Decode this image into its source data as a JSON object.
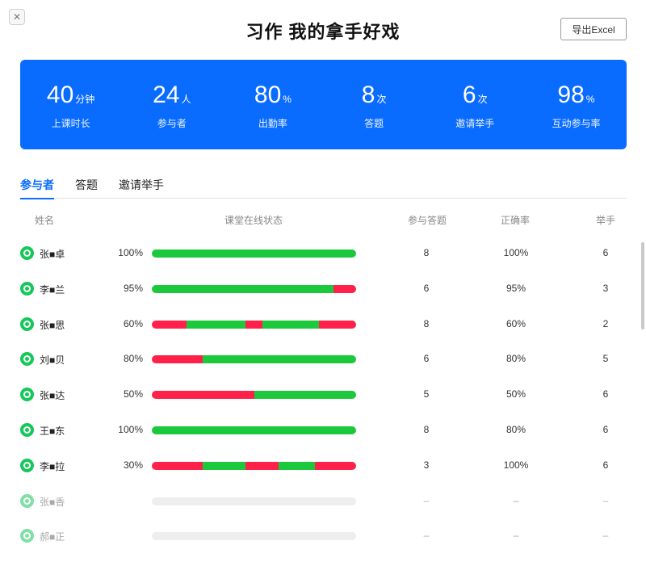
{
  "page": {
    "title": "习作 我的拿手好戏",
    "close_glyph": "✕"
  },
  "toolbar": {
    "export_label": "导出Excel"
  },
  "stats": [
    {
      "value": "40",
      "unit": "分钟",
      "label": "上课时长"
    },
    {
      "value": "24",
      "unit": "人",
      "label": "参与者"
    },
    {
      "value": "80",
      "unit": "%",
      "label": "出勤率"
    },
    {
      "value": "8",
      "unit": "次",
      "label": "答题"
    },
    {
      "value": "6",
      "unit": "次",
      "label": "邀请举手"
    },
    {
      "value": "98",
      "unit": "%",
      "label": "互动参与率"
    }
  ],
  "tabs": [
    {
      "label": "参与者",
      "active": true
    },
    {
      "label": "答题",
      "active": false
    },
    {
      "label": "邀请举手",
      "active": false
    }
  ],
  "table": {
    "headers": {
      "name": "姓名",
      "status": "课堂在线状态",
      "answers": "参与答题",
      "accuracy": "正确率",
      "hands": "举手"
    },
    "colors": {
      "online": "#1dc93c",
      "offline": "#ff2149",
      "empty": "#eeeeee"
    },
    "rows": [
      {
        "name": "张■卓",
        "pct": "100%",
        "segments": [
          [
            "online",
            1
          ]
        ],
        "answers": "8",
        "accuracy": "100%",
        "hands": "6",
        "active": true
      },
      {
        "name": "李■兰",
        "pct": "95%",
        "segments": [
          [
            "online",
            0.89
          ],
          [
            "offline",
            0.11
          ]
        ],
        "answers": "6",
        "accuracy": "95%",
        "hands": "3",
        "active": true
      },
      {
        "name": "张■思",
        "pct": "60%",
        "segments": [
          [
            "offline",
            0.17
          ],
          [
            "online",
            0.29
          ],
          [
            "offline",
            0.08
          ],
          [
            "online",
            0.28
          ],
          [
            "offline",
            0.18
          ]
        ],
        "answers": "8",
        "accuracy": "60%",
        "hands": "2",
        "active": true
      },
      {
        "name": "刘■贝",
        "pct": "80%",
        "segments": [
          [
            "offline",
            0.25
          ],
          [
            "online",
            0.75
          ]
        ],
        "answers": "6",
        "accuracy": "80%",
        "hands": "5",
        "active": true
      },
      {
        "name": "张■达",
        "pct": "50%",
        "segments": [
          [
            "offline",
            0.5
          ],
          [
            "online",
            0.5
          ]
        ],
        "answers": "5",
        "accuracy": "50%",
        "hands": "6",
        "active": true
      },
      {
        "name": "王■东",
        "pct": "100%",
        "segments": [
          [
            "online",
            1
          ]
        ],
        "answers": "8",
        "accuracy": "80%",
        "hands": "6",
        "active": true
      },
      {
        "name": "李■拉",
        "pct": "30%",
        "segments": [
          [
            "offline",
            0.25
          ],
          [
            "online",
            0.21
          ],
          [
            "offline",
            0.16
          ],
          [
            "online",
            0.18
          ],
          [
            "offline",
            0.2
          ]
        ],
        "answers": "3",
        "accuracy": "100%",
        "hands": "6",
        "active": true
      },
      {
        "name": "张■香",
        "pct": "",
        "segments": [],
        "answers": "–",
        "accuracy": "–",
        "hands": "–",
        "active": false
      },
      {
        "name": "郝■正",
        "pct": "",
        "segments": [],
        "answers": "–",
        "accuracy": "–",
        "hands": "–",
        "active": false
      }
    ]
  }
}
